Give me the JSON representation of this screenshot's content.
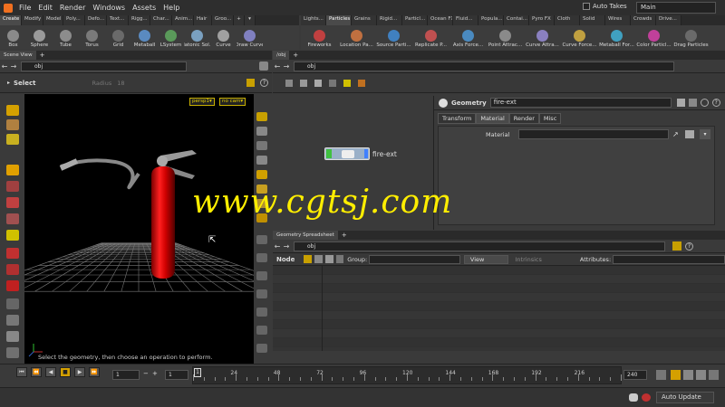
{
  "menubar": {
    "items": [
      "File",
      "Edit",
      "Render",
      "Windows",
      "Assets",
      "Help"
    ],
    "auto_takes": "Auto Takes",
    "desktop": "Main"
  },
  "shelf_left": {
    "tabs": [
      "Create",
      "Modify",
      "Model",
      "Poly...",
      "Defo...",
      "Text...",
      "Rigg...",
      "Char...",
      "Anim...",
      "Hair",
      "Groo..."
    ],
    "tools": [
      {
        "label": "Box",
        "color": "#8a8a8a"
      },
      {
        "label": "Sphere",
        "color": "#9a9a9a"
      },
      {
        "label": "Tube",
        "color": "#8c8c8c"
      },
      {
        "label": "Torus",
        "color": "#7a7a7a"
      },
      {
        "label": "Grid",
        "color": "#6a6a6a"
      },
      {
        "label": "Metaball",
        "color": "#5a8ac0"
      },
      {
        "label": "LSystem",
        "color": "#5a9a5a"
      },
      {
        "label": "Platonic Sol...",
        "color": "#7aa0c0"
      },
      {
        "label": "Curve",
        "color": "#a0a0a0"
      },
      {
        "label": "Draw Curve",
        "color": "#8080c0"
      }
    ]
  },
  "shelf_right": {
    "tabs": [
      "Lights...",
      "Particles",
      "Grains",
      "Rigid...",
      "Particl...",
      "Ocean FX",
      "Fluid...",
      "Popula...",
      "Contai...",
      "Pyro FX",
      "Cloth",
      "Solid",
      "Wires",
      "Crowds",
      "Drive..."
    ],
    "tools": [
      {
        "label": "Fireworks",
        "color": "#c04040"
      },
      {
        "label": "Location Pa...",
        "color": "#c07040"
      },
      {
        "label": "Source Parti...",
        "color": "#4080c0"
      },
      {
        "label": "Replicate P...",
        "color": "#c05050"
      },
      {
        "label": "Axis Force...",
        "color": "#4a8ac0"
      },
      {
        "label": "Point Attrac...",
        "color": "#8a8a8a"
      },
      {
        "label": "Curve Attra...",
        "color": "#8a80c0"
      },
      {
        "label": "Curve Force...",
        "color": "#c0a040"
      },
      {
        "label": "Metaball For...",
        "color": "#40a0c0"
      },
      {
        "label": "Color Particl...",
        "color": "#c0409a"
      },
      {
        "label": "Drag Particles",
        "color": "#6a6a6a"
      }
    ]
  },
  "scene_view": {
    "tab": "Scene View",
    "path": "obj",
    "select_label": "Select",
    "radius_label": "Radius",
    "radius_value": "18",
    "persp": "persp1▾",
    "cam": "no cam▾",
    "hint": "Select the geometry, then choose an operation to perform."
  },
  "network": {
    "tab": "/obj",
    "path": "obj",
    "node_name": "fire-ext"
  },
  "params": {
    "type": "Geometry",
    "name": "fire-ext",
    "tabs": [
      "Transform",
      "Material",
      "Render",
      "Misc"
    ],
    "material_label": "Material"
  },
  "spreadsheet": {
    "tab": "Geometry Spreadsheet",
    "path": "obj",
    "node_label": "Node",
    "group_label": "Group:",
    "view_label": "View",
    "intrinsics_label": "Intrinsics",
    "attributes_label": "Attributes:"
  },
  "timeline": {
    "current_frame": "1",
    "start_frame": "1",
    "end_frame": "240",
    "ticks": [
      "24",
      "48",
      "72",
      "96",
      "120",
      "144",
      "168",
      "192",
      "216"
    ],
    "tick_start": "1"
  },
  "status": {
    "auto_update": "Auto Update"
  },
  "watermark": "www.cgtsj.com"
}
